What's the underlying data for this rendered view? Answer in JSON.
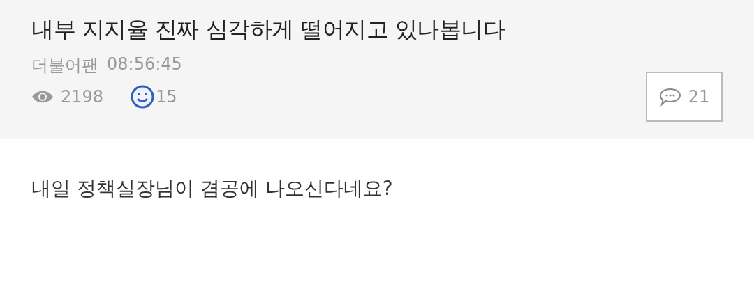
{
  "post": {
    "title": "내부 지지율 진짜 심각하게 떨어지고 있나봅니다",
    "author": "더불어팬",
    "time": "08:56:45",
    "views": "2198",
    "likes": "15",
    "comments": "21"
  },
  "body": "내일 정책실장님이 겸공에 나오신다네요?"
}
